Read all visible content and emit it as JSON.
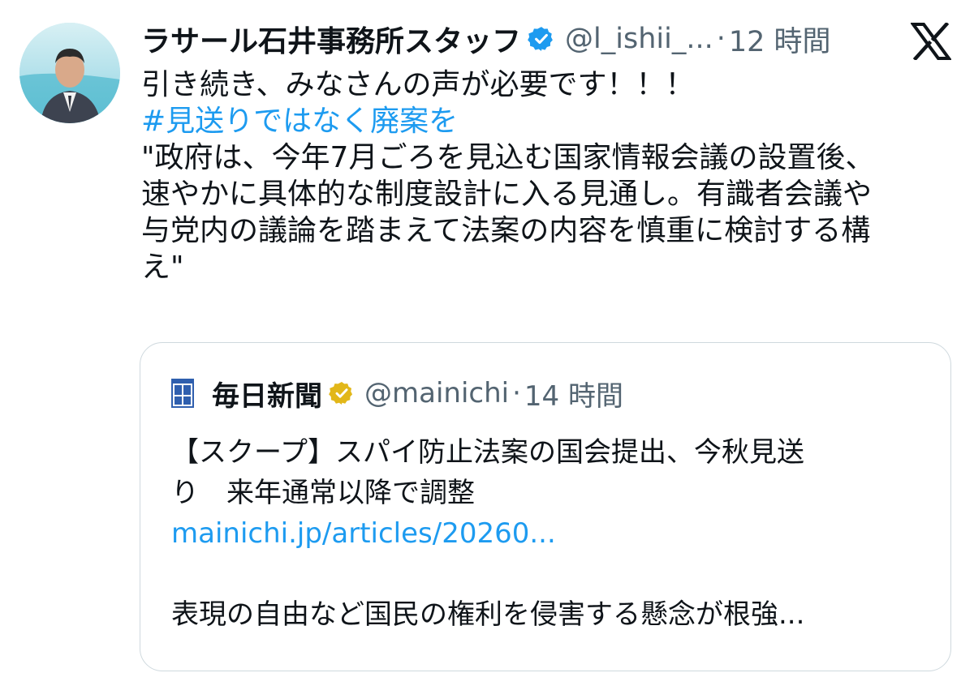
{
  "tweet": {
    "display_name": "ラサール石井事務所スタッフ",
    "handle": "@l_ishii_...",
    "separator": "·",
    "time": "12 時間",
    "line1": "引き続き、みなさんの声が必要です！！！",
    "hashtag": "#見送りではなく廃案を",
    "quote_lines": [
      "\"政府は、今年7月ごろを見込む国家情報会議の設置後、",
      "速やかに具体的な制度設計に入る見通し。有識者会議や",
      "与党内の議論を踏まえて法案の内容を慎重に検討する構",
      "え\""
    ]
  },
  "quoted": {
    "display_name": "毎日新聞",
    "handle": "@mainichi",
    "separator": "·",
    "time": "14 時間",
    "line1": "【スクープ】スパイ防止法案の国会提出、今秋見送",
    "line2": "り　来年通常以降で調整",
    "link": "mainichi.jp/articles/20260...",
    "line3": "表現の自由など国民の権利を侵害する懸念が根強..."
  },
  "colors": {
    "text": "#0f1419",
    "secondary": "#536471",
    "link": "#1d9bf0",
    "border": "#cfd9de",
    "verified_blue": "#1d9bf0",
    "verified_gold": "#e2b719"
  },
  "icons": {
    "avatar": "user-avatar",
    "verified": "verified-badge-icon",
    "x_logo": "x-logo-icon",
    "mainichi_logo": "mainichi-logo-icon",
    "gold_verified": "gold-verified-badge-icon"
  }
}
